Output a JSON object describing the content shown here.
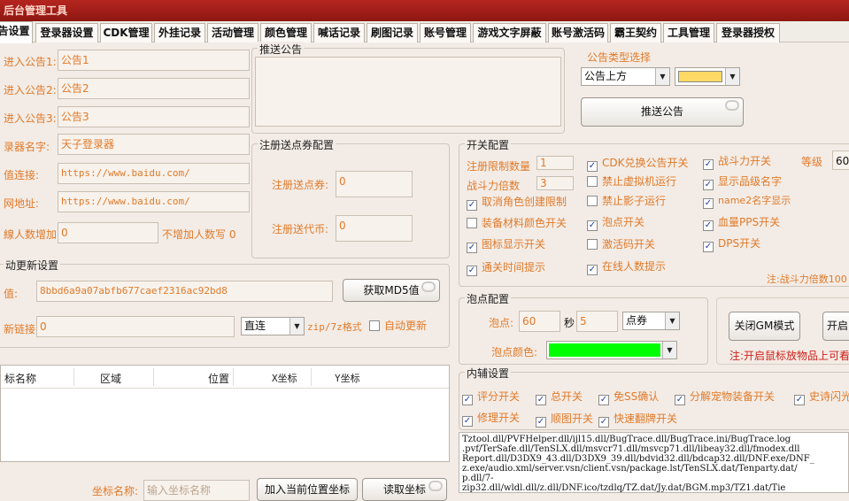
{
  "window": {
    "title": "后台管理工具"
  },
  "tabs": [
    {
      "label": "公告设置"
    },
    {
      "label": "登录器设置"
    },
    {
      "label": "CDK管理"
    },
    {
      "label": "外挂记录"
    },
    {
      "label": "活动管理"
    },
    {
      "label": "颜色管理"
    },
    {
      "label": "喊话记录"
    },
    {
      "label": "刷图记录"
    },
    {
      "label": "账号管理"
    },
    {
      "label": "游戏文字屏蔽"
    },
    {
      "label": "账号激活码"
    },
    {
      "label": "霸王契约"
    },
    {
      "label": "工具管理"
    },
    {
      "label": "登录器授权"
    }
  ],
  "left": {
    "notice1": {
      "label": "进入公告1:",
      "value": "公告1"
    },
    "notice2": {
      "label": "进入公告2:",
      "value": "公告2"
    },
    "notice3": {
      "label": "进入公告3:",
      "value": "公告3"
    },
    "launcher_name": {
      "label": "录器名字:",
      "value": "天子登录器"
    },
    "site_link": {
      "label": "值连接:",
      "value": "https://www.baidu.com/"
    },
    "web_url": {
      "label": "网地址:",
      "value": "https://www.baidu.com/"
    },
    "add_people": {
      "label": "線人数增加:",
      "value": "0",
      "note": "不增加人数写 0"
    }
  },
  "push_notice": {
    "title": "推送公告",
    "text": ""
  },
  "register_voucher": {
    "title": "注册送点券配置",
    "points_label": "注册送点券:",
    "points_value": "0",
    "coins_label": "注册送代币:",
    "coins_value": "0"
  },
  "notice_type": {
    "title": "公告类型选择",
    "position": "公告上方",
    "color": "#ffd966",
    "push_button": "推送公告"
  },
  "switches": {
    "title": "开关配置",
    "reg_limit_label": "注册限制数量",
    "reg_limit_value": "1",
    "power_mult_label": "战斗力倍数",
    "power_mult_value": "3",
    "level_label": "等级",
    "level_value": "60",
    "items": [
      {
        "label": "CDK兑换公告开关",
        "checked": true
      },
      {
        "label": "战斗力开关",
        "checked": true
      },
      {
        "label": "禁止虚拟机运行",
        "checked": false
      },
      {
        "label": "显示品级名字",
        "checked": true
      },
      {
        "label": "取消角色创建限制",
        "checked": true
      },
      {
        "label": "禁止影子运行",
        "checked": false
      },
      {
        "label": "name2名字显示",
        "checked": true
      },
      {
        "label": "装备材料颜色开关",
        "checked": false
      },
      {
        "label": "泡点开关",
        "checked": true
      },
      {
        "label": "血量PPS开关",
        "checked": true
      },
      {
        "label": "图标显示开关",
        "checked": true
      },
      {
        "label": "激活码开关",
        "checked": false
      },
      {
        "label": "DPS开关",
        "checked": true
      },
      {
        "label": "通关时间提示",
        "checked": true
      },
      {
        "label": "在线人数提示",
        "checked": true
      }
    ],
    "note": "注:战斗力倍数100"
  },
  "auto_update": {
    "title": "动更新设置",
    "md5_label": "值:",
    "md5_value": "8bbd6a9a07abfb677caef2316ac92bd8",
    "md5_button": "获取MD5值",
    "link_label": "新链接:",
    "link_value": "0",
    "mode": "直连",
    "format_hint": "zip/7z格式",
    "auto_update_label": "自动更新",
    "auto_update_checked": false
  },
  "coords_table": {
    "headers": [
      "标名称",
      "区域",
      "位置",
      "X坐标",
      "Y坐标"
    ],
    "name_label": "坐标名称:",
    "name_placeholder": "输入坐标名称",
    "add_button": "加入当前位置坐标",
    "read_button": "读取坐标"
  },
  "bubble": {
    "title": "泡点配置",
    "point_label": "泡点:",
    "point_value": "60",
    "sec_label": "秒",
    "sec_value": "5",
    "type": "点券",
    "color_label": "泡点颜色:",
    "color": "#00ff00"
  },
  "gm": {
    "close_button": "关闭GM模式",
    "open_button": "开启",
    "note": "注:开启鼠标放物品上可看"
  },
  "assist": {
    "title": "内辅设置",
    "items": [
      {
        "label": "评分开关",
        "checked": true
      },
      {
        "label": "总开关",
        "checked": true
      },
      {
        "label": "免SS确认",
        "checked": true
      },
      {
        "label": "分解宠物装备开关",
        "checked": true
      },
      {
        "label": "史诗闪光",
        "checked": true
      },
      {
        "label": "修理开关",
        "checked": true
      },
      {
        "label": "顺图开关",
        "checked": true
      },
      {
        "label": "快速翻牌开关",
        "checked": true
      }
    ]
  },
  "file_list": {
    "lines": [
      "Tztool.dll/PVFHelper.dll/ijl15.dll/BugTrace.dll/BugTrace.ini/BugTrace.log",
      ".pvf/TerSafe.dll/TenSLX.dll/msvcr71.dll/msvcp71.dll/libeay32.dll/fmodex.dll",
      "Report.dll/D3DX9_43.dll/D3DX9_39.dll/bdvid32.dll/bdcap32.dll/DNF.exe/DNF_",
      "z.exe/audio.xml/server.vsn/client.vsn/package.lst/TenSLX.dat/Tenparty.dat/",
      "p.dll/7-",
      "zip32.dll/wldl.dll/z.dll/DNF.ico/tzdlq/TZ.dat/Jy.dat/BGM.mp3/TZ1.dat/Tie"
    ]
  }
}
